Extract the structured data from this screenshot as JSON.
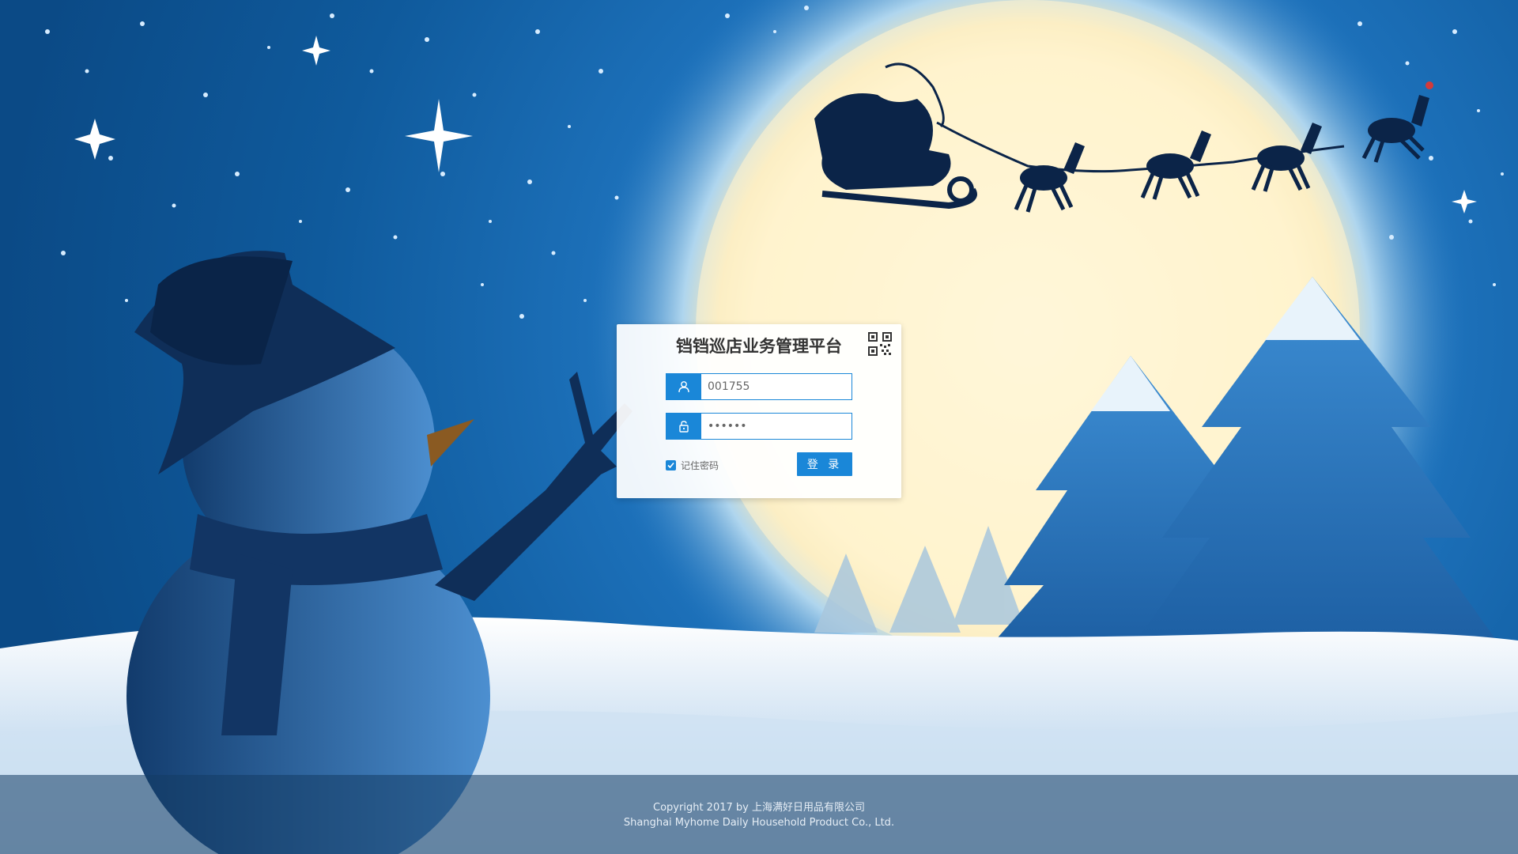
{
  "app": {
    "title": "铛铛巡店业务管理平台"
  },
  "login": {
    "username_value": "001755",
    "password_value": "••••••",
    "remember_label": "记住密码",
    "login_label": "登 录",
    "remember_checked": true
  },
  "icons": {
    "qr": "qr-code-icon",
    "user": "user-icon",
    "lock": "lock-icon",
    "check": "check-icon"
  },
  "colors": {
    "accent": "#1a87d8"
  },
  "footer": {
    "line1": "Copyright 2017 by 上海满好日用品有限公司",
    "line2": "Shanghai Myhome Daily Household Product Co., Ltd."
  }
}
